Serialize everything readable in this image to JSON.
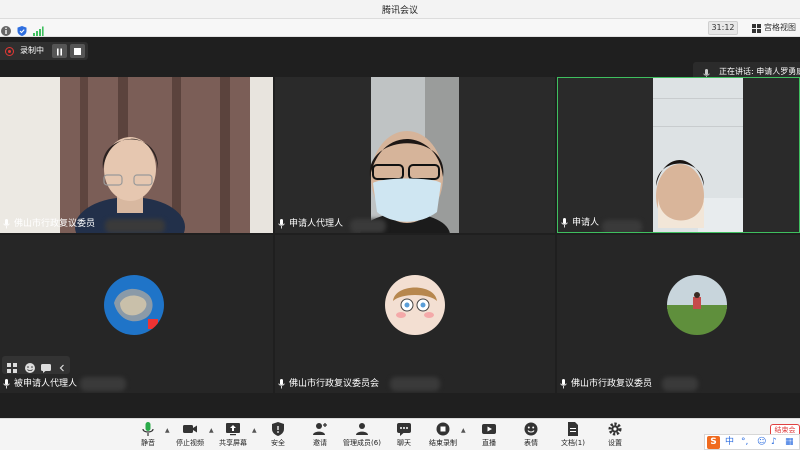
{
  "window": {
    "title": "腾讯会议"
  },
  "statusbar": {
    "timer": "31:12",
    "gallery_label": "宫格视图"
  },
  "recording": {
    "label": "录制中"
  },
  "speaking": {
    "text": "正在讲话: 申请人罗勇康"
  },
  "tiles": [
    {
      "name": "佛山市行政复议委员",
      "kind": "video"
    },
    {
      "name": "申请人代理人",
      "kind": "video"
    },
    {
      "name": "申请人",
      "kind": "video"
    },
    {
      "name": "被申请人代理人",
      "kind": "audio"
    },
    {
      "name": "佛山市行政复议委员会",
      "kind": "audio"
    },
    {
      "name": "佛山市行政复议委员",
      "kind": "audio"
    }
  ],
  "toolbar": {
    "items": [
      {
        "label": "静音",
        "icon": "mic-icon"
      },
      {
        "label": "停止视频",
        "icon": "camera-icon"
      },
      {
        "label": "共享屏幕",
        "icon": "share-screen-icon"
      },
      {
        "label": "安全",
        "icon": "shield-icon"
      },
      {
        "label": "邀请",
        "icon": "invite-icon"
      },
      {
        "label": "管理成员(6)",
        "icon": "members-icon"
      },
      {
        "label": "聊天",
        "icon": "chat-icon"
      },
      {
        "label": "结束录制",
        "icon": "stop-record-icon"
      },
      {
        "label": "直播",
        "icon": "live-icon"
      },
      {
        "label": "表情",
        "icon": "emoji-icon"
      },
      {
        "label": "文档(1)",
        "icon": "document-icon"
      },
      {
        "label": "设置",
        "icon": "gear-icon"
      }
    ],
    "end_label": "结束会"
  },
  "ime": {
    "logo": "S",
    "lang": "中"
  },
  "colors": {
    "accent_green": "#3fbf5f",
    "record_red": "#e53935",
    "ime_orange": "#f06a1e"
  }
}
